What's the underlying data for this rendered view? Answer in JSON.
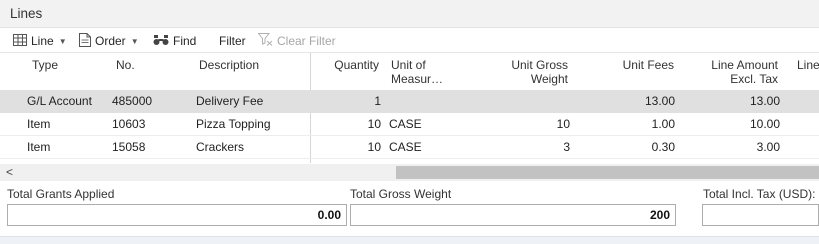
{
  "part": {
    "title": "Lines"
  },
  "toolbar": {
    "line_label": "Line",
    "order_label": "Order",
    "find_label": "Find",
    "filter_label": "Filter",
    "clear_filter_label": "Clear Filter"
  },
  "columns": {
    "type": "Type",
    "no": "No.",
    "description": "Description",
    "quantity": "Quantity",
    "unit_of_measure_1": "Unit of",
    "unit_of_measure_2": "Measur…",
    "unit_gross_weight_1": "Unit Gross",
    "unit_gross_weight_2": "Weight",
    "unit_fees": "Unit Fees",
    "line_amount_1": "Line Amount",
    "line_amount_2": "Excl. Tax",
    "line_cut": "Line"
  },
  "rows": [
    {
      "type": "G/L Account",
      "no": "485000",
      "description": "Delivery Fee",
      "quantity": "1",
      "uom": "",
      "gross_weight": "",
      "unit_fees": "13.00",
      "line_amount": "13.00"
    },
    {
      "type": "Item",
      "no": "10603",
      "description": "Pizza Topping",
      "quantity": "10",
      "uom": "CASE",
      "gross_weight": "10",
      "unit_fees": "1.00",
      "line_amount": "10.00"
    },
    {
      "type": "Item",
      "no": "15058",
      "description": "Crackers",
      "quantity": "10",
      "uom": "CASE",
      "gross_weight": "3",
      "unit_fees": "0.30",
      "line_amount": "3.00"
    }
  ],
  "scroll": {
    "left_arrow": "<"
  },
  "totals": {
    "grants_label": "Total Grants Applied",
    "grants_value": "0.00",
    "gross_weight_label": "Total Gross Weight",
    "gross_weight_value": "200",
    "incl_tax_label": "Total Incl. Tax (USD):",
    "incl_tax_value": ""
  }
}
